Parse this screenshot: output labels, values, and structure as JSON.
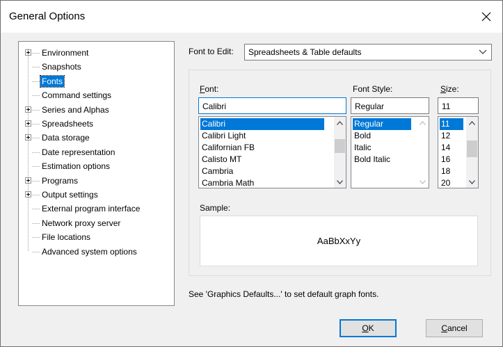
{
  "window": {
    "title": "General Options"
  },
  "tree": {
    "items": [
      {
        "label": "Environment",
        "expandable": true,
        "selected": false
      },
      {
        "label": "Snapshots",
        "expandable": false,
        "selected": false
      },
      {
        "label": "Fonts",
        "expandable": false,
        "selected": true
      },
      {
        "label": "Command settings",
        "expandable": false,
        "selected": false
      },
      {
        "label": "Series and Alphas",
        "expandable": true,
        "selected": false
      },
      {
        "label": "Spreadsheets",
        "expandable": true,
        "selected": false
      },
      {
        "label": "Data storage",
        "expandable": true,
        "selected": false
      },
      {
        "label": "Date representation",
        "expandable": false,
        "selected": false
      },
      {
        "label": "Estimation options",
        "expandable": false,
        "selected": false
      },
      {
        "label": "Programs",
        "expandable": true,
        "selected": false
      },
      {
        "label": "Output settings",
        "expandable": true,
        "selected": false
      },
      {
        "label": "External program interface",
        "expandable": false,
        "selected": false
      },
      {
        "label": "Network proxy server",
        "expandable": false,
        "selected": false
      },
      {
        "label": "File locations",
        "expandable": false,
        "selected": false
      },
      {
        "label": "Advanced system options",
        "expandable": false,
        "selected": false
      }
    ]
  },
  "font_to_edit": {
    "label": "Font to Edit:",
    "value": "Spreadsheets & Table defaults"
  },
  "font": {
    "label_mnemonic": "F",
    "label_rest": "ont:",
    "value": "Calibri",
    "options": [
      "Calibri",
      "Calibri Light",
      "Californian FB",
      "Calisto MT",
      "Cambria",
      "Cambria Math"
    ],
    "selected": "Calibri"
  },
  "font_style": {
    "label": "Font Style:",
    "value": "Regular",
    "options": [
      "Regular",
      "Bold",
      "Italic",
      "Bold Italic"
    ],
    "selected": "Regular"
  },
  "size": {
    "label_mnemonic": "S",
    "label_rest": "ize:",
    "value": "11",
    "options": [
      "11",
      "12",
      "14",
      "16",
      "18",
      "20"
    ],
    "selected": "11"
  },
  "sample": {
    "label": "Sample:",
    "text": "AaBbXxYy"
  },
  "hint": "See 'Graphics Defaults...' to set default graph fonts.",
  "buttons": {
    "ok_mnemonic": "O",
    "ok_rest": "K",
    "cancel_mnemonic": "C",
    "cancel_rest": "ancel"
  }
}
